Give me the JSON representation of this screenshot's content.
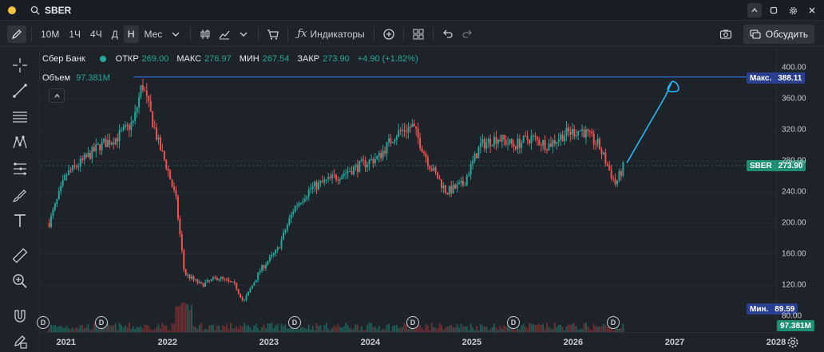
{
  "topbar": {
    "ticker": "SBER",
    "status_color": "#f5c542"
  },
  "toolbar": {
    "timeframes": [
      "10М",
      "1Ч",
      "4Ч",
      "Д",
      "Н",
      "Мес"
    ],
    "active_timeframe": "Н",
    "indicators_label": "Индикаторы",
    "discuss_label": "Обсудить"
  },
  "legend": {
    "name": "Сбер Банк",
    "dot_color": "#26a69a",
    "open_label": "ОТКР",
    "open": "269.00",
    "high_label": "МАКС",
    "high": "276.97",
    "low_label": "МИН",
    "low": "267.54",
    "close_label": "ЗАКР",
    "close": "273.90",
    "change": "+4.90 (+1.82%)",
    "volume_label": "Объем",
    "volume": "97.381M"
  },
  "axis": {
    "y_ticks": [
      "400.00",
      "360.00",
      "320.00",
      "280.00",
      "240.00",
      "200.00",
      "160.00",
      "120.00",
      "80.00"
    ],
    "x_ticks": [
      "2021",
      "2022",
      "2023",
      "2024",
      "2025",
      "2026",
      "2027",
      "2028"
    ],
    "max_label": "Макс.",
    "max_value": "388.11",
    "min_label": "Мин.",
    "min_value": "89.59",
    "last_label": "SBER",
    "last_value": "273.90",
    "volume_value": "97.381M"
  },
  "dividend_marks": [
    "D",
    "D",
    "D",
    "D",
    "D",
    "D"
  ],
  "chart_data": {
    "type": "candlestick",
    "ylim": [
      80,
      400
    ],
    "xlim": [
      "2020-10",
      "2028-01"
    ],
    "x": [
      "2020-11",
      "2021-01",
      "2021-03",
      "2021-05",
      "2021-07",
      "2021-09",
      "2021-10",
      "2021-11",
      "2021-12",
      "2022-01",
      "2022-02",
      "2022-03",
      "2022-05",
      "2022-07",
      "2022-09",
      "2022-10",
      "2022-12",
      "2023-02",
      "2023-04",
      "2023-06",
      "2023-08",
      "2023-10",
      "2023-12",
      "2024-02",
      "2024-04",
      "2024-06",
      "2024-08",
      "2024-10",
      "2024-12",
      "2025-02",
      "2025-04",
      "2025-06",
      "2025-08",
      "2025-10",
      "2025-12",
      "2026-02",
      "2026-04",
      "2026-06",
      "2026-07"
    ],
    "close": [
      200,
      262,
      280,
      300,
      310,
      330,
      380,
      340,
      300,
      270,
      230,
      135,
      120,
      130,
      120,
      98,
      140,
      165,
      220,
      245,
      255,
      265,
      275,
      285,
      315,
      325,
      275,
      240,
      250,
      300,
      310,
      300,
      310,
      300,
      315,
      320,
      300,
      250,
      274
    ],
    "max": 388.11,
    "min": 89.59,
    "last": 273.9
  },
  "colors": {
    "up": "#26a69a",
    "down": "#ef5350",
    "line_blue": "#2f6fd6",
    "annotation": "#29b6f6",
    "background": "#1e2229"
  }
}
